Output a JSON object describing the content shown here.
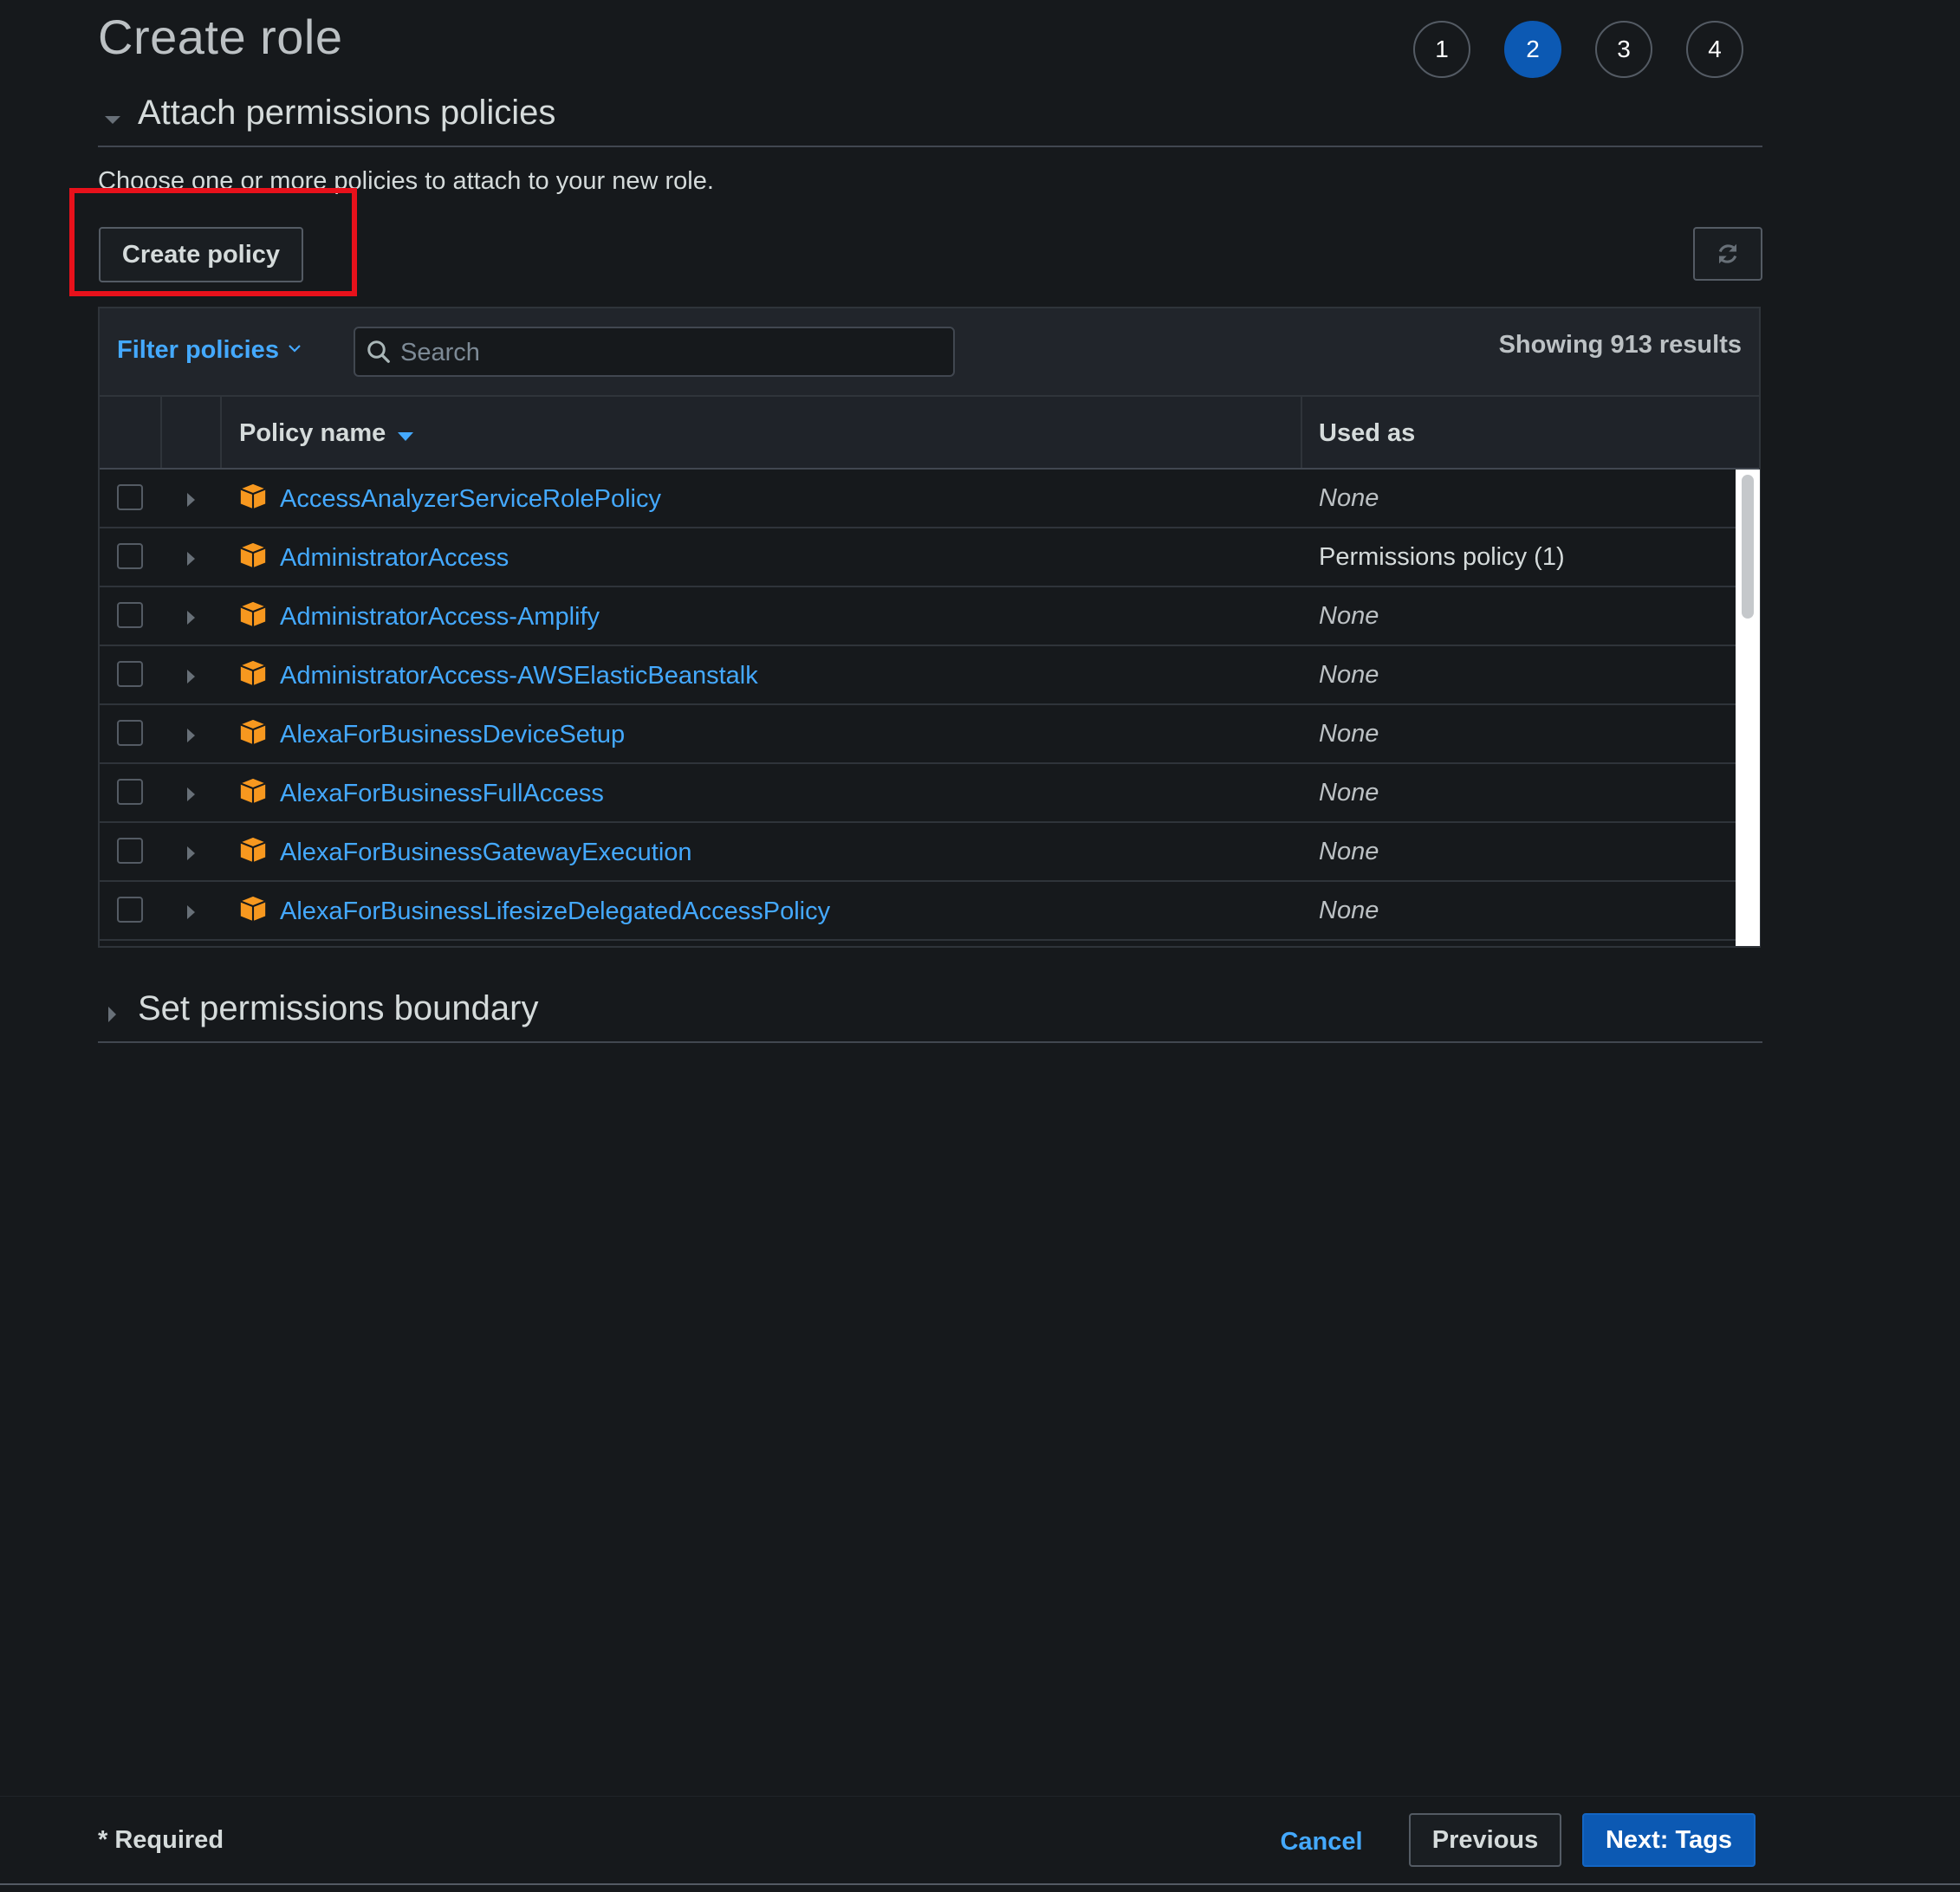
{
  "header": {
    "title": "Create role",
    "steps": [
      {
        "label": "1",
        "active": false
      },
      {
        "label": "2",
        "active": true
      },
      {
        "label": "3",
        "active": false
      },
      {
        "label": "4",
        "active": false
      }
    ]
  },
  "attach_section": {
    "title": "Attach permissions policies",
    "intro": "Choose one or more policies to attach to your new role.",
    "create_policy_label": "Create policy",
    "refresh_icon": "refresh-icon"
  },
  "table": {
    "filter_label": "Filter policies",
    "search_placeholder": "Search",
    "results_text": "Showing 913 results",
    "columns": {
      "policy_name": "Policy name",
      "used_as": "Used as"
    },
    "rows": [
      {
        "name": "AccessAnalyzerServiceRolePolicy",
        "used_as": "None"
      },
      {
        "name": "AdministratorAccess",
        "used_as": "Permissions policy (1)"
      },
      {
        "name": "AdministratorAccess-Amplify",
        "used_as": "None"
      },
      {
        "name": "AdministratorAccess-AWSElasticBeanstalk",
        "used_as": "None"
      },
      {
        "name": "AlexaForBusinessDeviceSetup",
        "used_as": "None"
      },
      {
        "name": "AlexaForBusinessFullAccess",
        "used_as": "None"
      },
      {
        "name": "AlexaForBusinessGatewayExecution",
        "used_as": "None"
      },
      {
        "name": "AlexaForBusinessLifesizeDelegatedAccessPolicy",
        "used_as": "None"
      }
    ]
  },
  "boundary_section": {
    "title": "Set permissions boundary"
  },
  "footer": {
    "required_label": "* Required",
    "cancel_label": "Cancel",
    "previous_label": "Previous",
    "next_label": "Next: Tags"
  },
  "colors": {
    "accent_link": "#44a9ff",
    "primary_button": "#0c59b3",
    "package_icon": "#f7981f",
    "highlight": "#e8111b"
  }
}
